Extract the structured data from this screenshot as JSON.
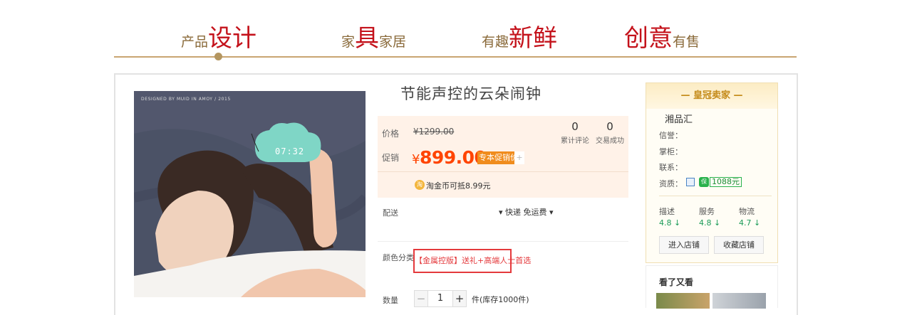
{
  "banner": {
    "slogans": [
      {
        "small": "产品",
        "big": "设计"
      },
      {
        "small1": "家",
        "big": "具",
        "small2": "家居"
      },
      {
        "small": "有趣",
        "big": "新鲜"
      },
      {
        "big": "创意",
        "small": "有售"
      }
    ],
    "colors": {
      "gold": "#c9a572",
      "red": "#c4121b"
    }
  },
  "product": {
    "photo_caption": "DESIGNED BY MUID IN AMOY  /  2015",
    "clock_time": "07:32",
    "title": "节能声控的云朵闹钟",
    "price_label": "价格",
    "original_price": "¥1299.00",
    "promo_label": "促销",
    "currency": "¥",
    "promo_price": "899.00",
    "promo_tag": "专本促销价",
    "promo_more": "+",
    "stats": [
      {
        "value": "0",
        "label": "累计评论"
      },
      {
        "value": "0",
        "label": "交易成功"
      }
    ],
    "coin_icon": "淘",
    "coin_text": "淘金币可抵8.99元",
    "delivery_label": "配送",
    "delivery_value": "▾  快递 免运费 ▾",
    "color_label": "颜色分类",
    "sku_option": "【金属控版】送礼+高端人士首选",
    "quantity_label": "数量",
    "quantity": "1",
    "minus": "−",
    "plus": "+",
    "stock_text": "件(库存1000件)",
    "colors": {
      "price": "#ff4400",
      "promo_tag": "#f08c1d",
      "sku_border": "#e4393c"
    }
  },
  "seller": {
    "header": "— 皇冠卖家 —",
    "shop_name": "湘品汇",
    "info": {
      "reputation": "信誉：",
      "owner": "掌柜：",
      "contact": "联系：",
      "qualification": "资质："
    },
    "deposit": "1088元",
    "coin_icon": "保",
    "scores": [
      {
        "label": "描述",
        "value": "4.8 ↓"
      },
      {
        "label": "服务",
        "value": "4.8 ↓"
      },
      {
        "label": "物流",
        "value": "4.7 ↓"
      }
    ],
    "enter_shop": "进入店铺",
    "fav_shop": "收藏店铺",
    "also_viewed": "看了又看",
    "colors": {
      "score": "#1c9b58",
      "header": "#c48a18"
    }
  }
}
